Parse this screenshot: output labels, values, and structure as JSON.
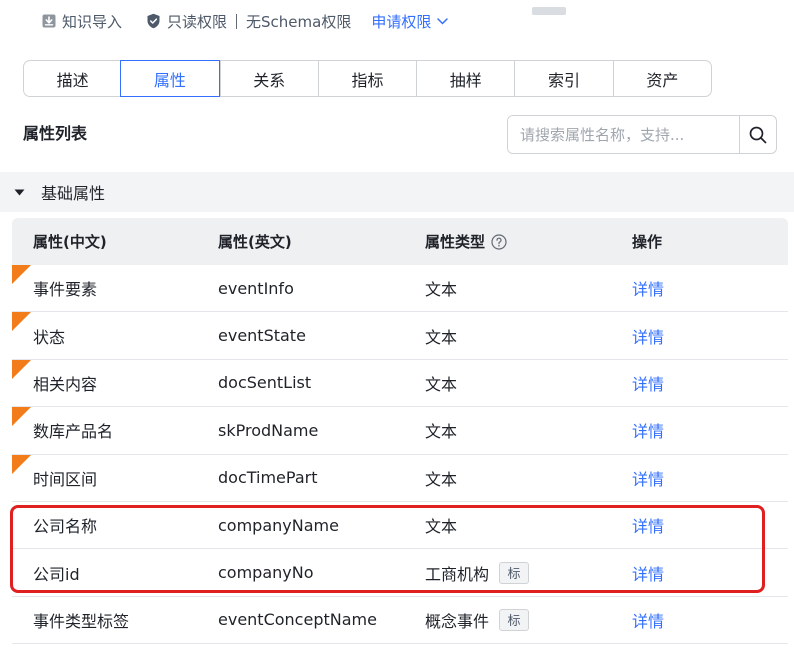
{
  "meta": {
    "import_label": "知识导入",
    "permission_label": "只读权限",
    "schema_label": "无Schema权限",
    "apply_label": "申请权限"
  },
  "tabs": [
    {
      "label": "描述",
      "active": false
    },
    {
      "label": "属性",
      "active": true
    },
    {
      "label": "关系",
      "active": false
    },
    {
      "label": "指标",
      "active": false
    },
    {
      "label": "抽样",
      "active": false
    },
    {
      "label": "索引",
      "active": false
    },
    {
      "label": "资产",
      "active": false
    }
  ],
  "list": {
    "title": "属性列表",
    "search_placeholder": "请搜索属性名称，支持..."
  },
  "group": {
    "title": "基础属性"
  },
  "table": {
    "headers": [
      "属性(中文)",
      "属性(英文)",
      "属性类型",
      "操作"
    ],
    "rows": [
      {
        "zh": "事件要素",
        "en": "eventInfo",
        "type": "文本",
        "badge": "",
        "action": "详情",
        "flagged": true
      },
      {
        "zh": "状态",
        "en": "eventState",
        "type": "文本",
        "badge": "",
        "action": "详情",
        "flagged": true
      },
      {
        "zh": "相关内容",
        "en": "docSentList",
        "type": "文本",
        "badge": "",
        "action": "详情",
        "flagged": true
      },
      {
        "zh": "数库产品名",
        "en": "skProdName",
        "type": "文本",
        "badge": "",
        "action": "详情",
        "flagged": true
      },
      {
        "zh": "时间区间",
        "en": "docTimePart",
        "type": "文本",
        "badge": "",
        "action": "详情",
        "flagged": true
      },
      {
        "zh": "公司名称",
        "en": "companyName",
        "type": "文本",
        "badge": "",
        "action": "详情",
        "flagged": false
      },
      {
        "zh": "公司id",
        "en": "companyNo",
        "type": "工商机构",
        "badge": "标",
        "action": "详情",
        "flagged": false
      },
      {
        "zh": "事件类型标签",
        "en": "eventConceptName",
        "type": "概念事件",
        "badge": "标",
        "action": "详情",
        "flagged": false
      }
    ]
  },
  "colors": {
    "accent": "#3370ff",
    "flag": "#f27b1a",
    "highlight": "#e02020"
  }
}
